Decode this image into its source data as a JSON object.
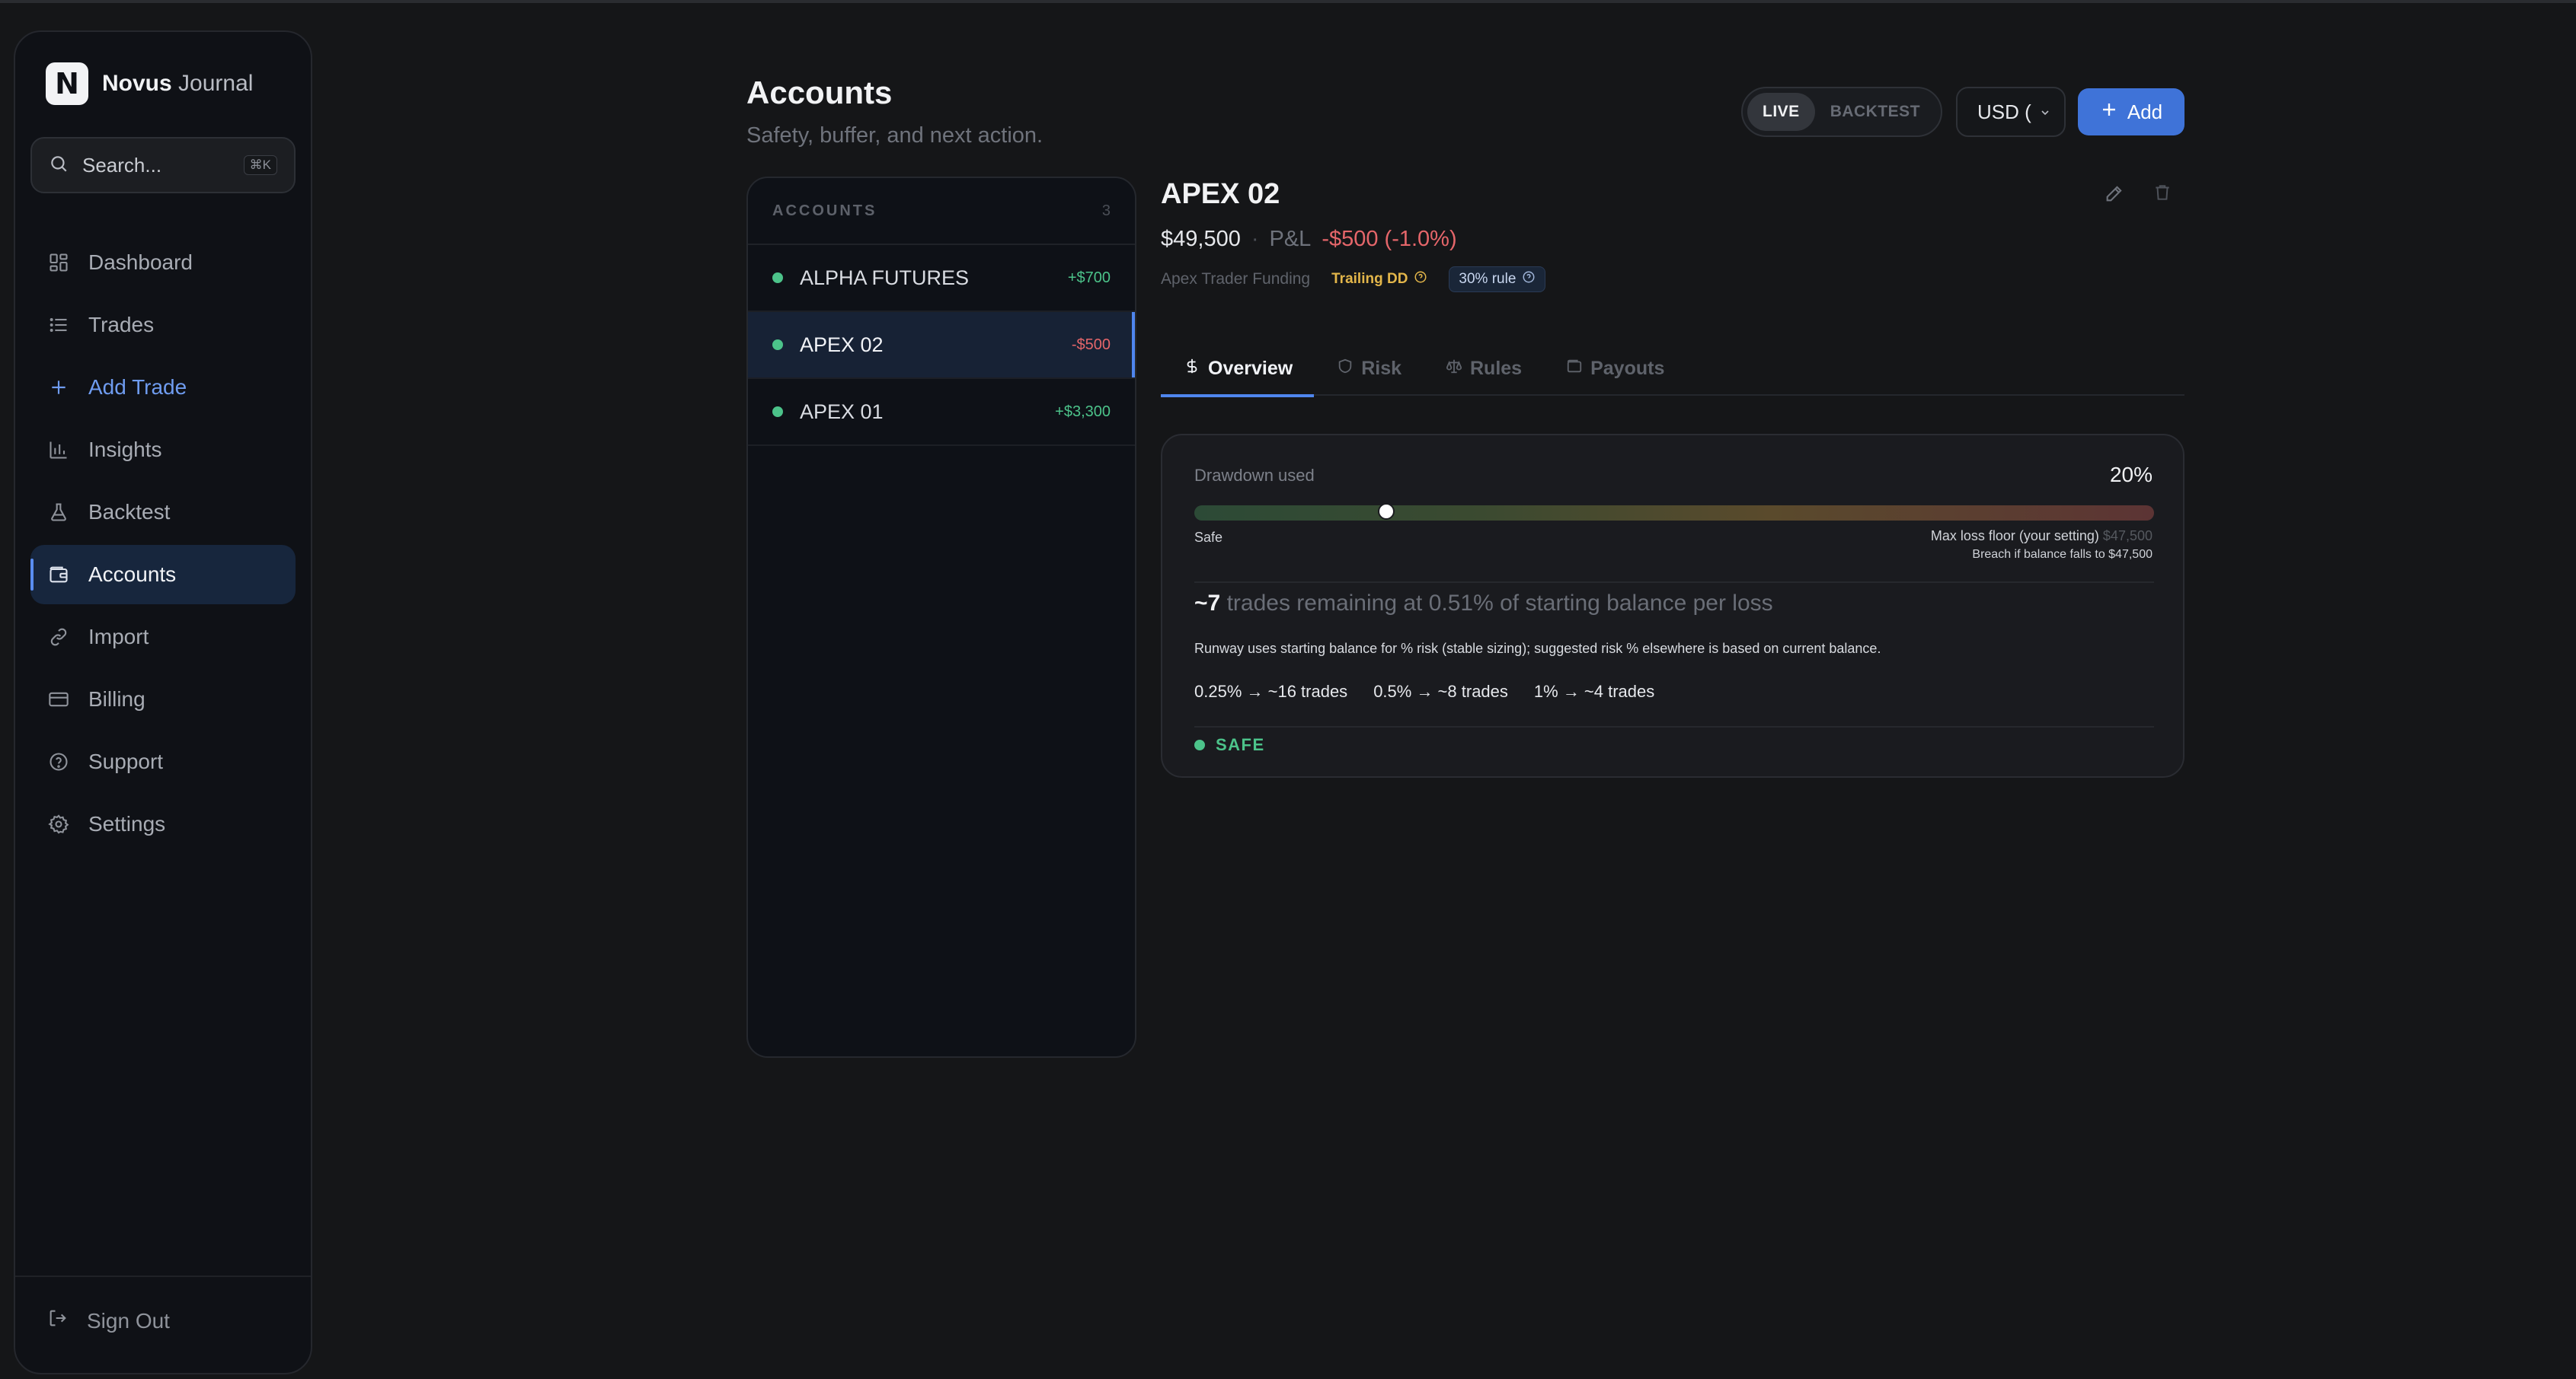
{
  "app": {
    "brand_bold": "Novus",
    "brand_light": "Journal",
    "logo_letter": "N"
  },
  "search": {
    "placeholder": "Search...",
    "shortcut": "⌘K"
  },
  "nav": {
    "items": [
      {
        "label": "Dashboard",
        "icon": "grid-icon"
      },
      {
        "label": "Trades",
        "icon": "list-icon"
      },
      {
        "label": "Add Trade",
        "icon": "plus-icon"
      },
      {
        "label": "Insights",
        "icon": "bar-chart-icon"
      },
      {
        "label": "Backtest",
        "icon": "flask-icon"
      },
      {
        "label": "Accounts",
        "icon": "wallet-icon",
        "active": true
      },
      {
        "label": "Import",
        "icon": "link-icon"
      },
      {
        "label": "Billing",
        "icon": "credit-card-icon"
      },
      {
        "label": "Support",
        "icon": "help-circle-icon"
      },
      {
        "label": "Settings",
        "icon": "gear-icon"
      }
    ],
    "signout": "Sign Out"
  },
  "header": {
    "title": "Accounts",
    "subtitle": "Safety, buffer, and next action.",
    "mode_live": "LIVE",
    "mode_backtest": "BACKTEST",
    "currency": "USD (",
    "add_label": "Add"
  },
  "accounts": {
    "heading": "ACCOUNTS",
    "count": "3",
    "rows": [
      {
        "name": "ALPHA FUTURES",
        "pnl": "+$700"
      },
      {
        "name": "APEX 02",
        "pnl": "-$500",
        "selected": true
      },
      {
        "name": "APEX 01",
        "pnl": "+$3,300"
      }
    ]
  },
  "detail": {
    "title": "APEX 02",
    "balance": "$49,500",
    "separator": "·",
    "pnl_label": "P&L",
    "pnl_value": "-$500 (-1.0%)",
    "firm": "Apex Trader Funding",
    "badge_dd": "Trailing DD",
    "badge_rule": "30% rule",
    "tabs": [
      "Overview",
      "Risk",
      "Rules",
      "Payouts"
    ],
    "card": {
      "label": "Drawdown used",
      "percent": "20%",
      "drawdown_fraction": 0.2,
      "safe_label": "Safe",
      "max_loss_label": "Max loss floor (your setting)",
      "max_loss_value": "$47,500",
      "breach_note": "Breach if balance falls to $47,500",
      "runway_count": "~7",
      "runway_text": "trades remaining at 0.51% of starting balance per loss",
      "note": "Runway uses starting balance for % risk (stable sizing); suggested risk % elsewhere is based on current balance.",
      "options": [
        "0.25% → ~16 trades",
        "0.5% → ~8 trades",
        "1% → ~4 trades"
      ],
      "status": "SAFE"
    }
  },
  "colors": {
    "accent": "#3f73d8",
    "positive": "#4cc38a",
    "negative": "#e5666a",
    "warning": "#e3b64a"
  }
}
